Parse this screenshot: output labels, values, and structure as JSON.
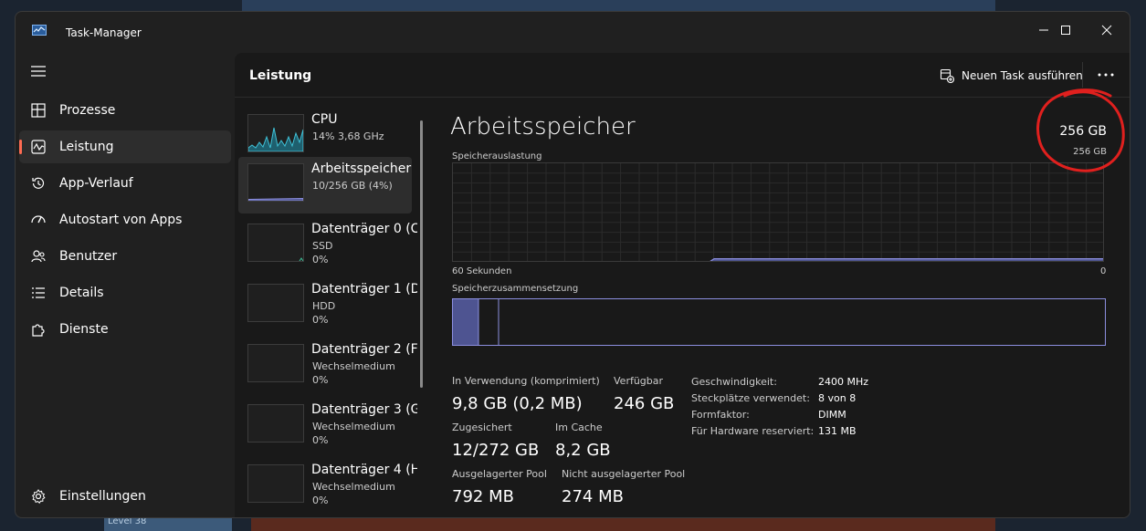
{
  "app": {
    "title": "Task-Manager"
  },
  "colors": {
    "accent": "#ff6b52",
    "memory": "#8c8fe0",
    "memory_fill": "#4e5491",
    "cpu": "#3fc2d8",
    "annotation": "#e0201e"
  },
  "background": {
    "level_text": "Level 38"
  },
  "nav": {
    "items": [
      {
        "label": "Prozesse",
        "icon": "processes-icon"
      },
      {
        "label": "Leistung",
        "icon": "performance-icon",
        "active": true
      },
      {
        "label": "App-Verlauf",
        "icon": "history-icon"
      },
      {
        "label": "Autostart von Apps",
        "icon": "startup-gauge-icon"
      },
      {
        "label": "Benutzer",
        "icon": "users-icon"
      },
      {
        "label": "Details",
        "icon": "details-list-icon"
      },
      {
        "label": "Dienste",
        "icon": "services-puzzle-icon"
      }
    ],
    "settings_label": "Einstellungen"
  },
  "header": {
    "title": "Leistung",
    "new_task_label": "Neuen Task ausführen"
  },
  "devices": [
    {
      "name": "CPU",
      "sub1": "14% 3,68 GHz",
      "sub2": ""
    },
    {
      "name": "Arbeitsspeicher",
      "sub1": "10/256 GB (4%)",
      "sub2": "",
      "active": true
    },
    {
      "name": "Datenträger 0 (C",
      "sub1": "SSD",
      "sub2": "0%"
    },
    {
      "name": "Datenträger 1 (D",
      "sub1": "HDD",
      "sub2": "0%"
    },
    {
      "name": "Datenträger 2 (F",
      "sub1": "Wechselmedium",
      "sub2": "0%"
    },
    {
      "name": "Datenträger 3 (G",
      "sub1": "Wechselmedium",
      "sub2": "0%"
    },
    {
      "name": "Datenträger 4 (H",
      "sub1": "Wechselmedium",
      "sub2": "0%"
    }
  ],
  "memory": {
    "title": "Arbeitsspeicher",
    "total": "256 GB",
    "graph_label": "Speicherauslastung",
    "graph_max": "256 GB",
    "time_label": "60 Sekunden",
    "time_right": "0",
    "composition_label": "Speicherzusammensetzung",
    "usage_percent": 4,
    "stats": {
      "in_use_label": "In Verwendung (komprimiert)",
      "in_use_value": "9,8 GB (0,2 MB)",
      "available_label": "Verfügbar",
      "available_value": "246 GB",
      "committed_label": "Zugesichert",
      "committed_value": "12/272 GB",
      "cached_label": "Im Cache",
      "cached_value": "8,2 GB",
      "paged_label": "Ausgelagerter Pool",
      "paged_value": "792 MB",
      "nonpaged_label": "Nicht ausgelagerter Pool",
      "nonpaged_value": "274 MB"
    },
    "details": [
      {
        "key": "Geschwindigkeit:",
        "value": "2400 MHz"
      },
      {
        "key": "Steckplätze verwendet:",
        "value": "8 von 8"
      },
      {
        "key": "Formfaktor:",
        "value": "DIMM"
      },
      {
        "key": "Für Hardware reserviert:",
        "value": "131 MB"
      }
    ]
  }
}
